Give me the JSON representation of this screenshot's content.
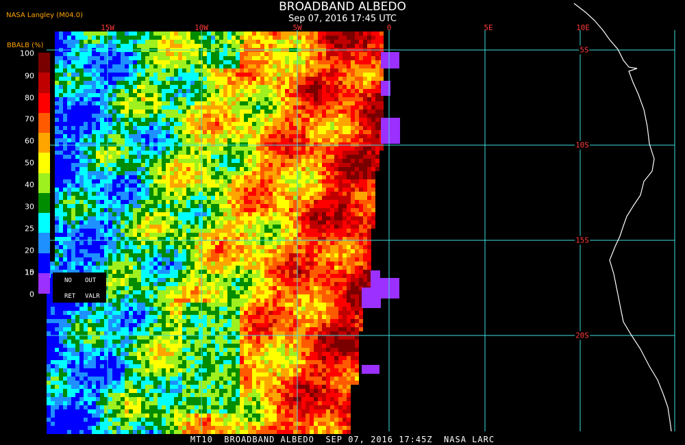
{
  "header": {
    "title": "BROADBAND ALBEDO",
    "subtitle": "Sep 07, 2016 17:45 UTC",
    "credit": "NASA Langley (M04.0)"
  },
  "footer": {
    "text": "MT10  BROADBAND ALBEDO  SEP 07, 2016 17:45Z  NASA LARC"
  },
  "map": {
    "longitude_labels": [
      "15W",
      "10W",
      "5W",
      "0",
      "5E",
      "10E"
    ],
    "latitude_labels": [
      "5S",
      "10S",
      "15S",
      "20S"
    ],
    "grid_color": "#40e0e0",
    "label_color": "#ff3b3b",
    "coast_color": "#ffffff",
    "background_color": "#000000",
    "dominant_features": [
      "stratocumulus cloud deck over ocean",
      "no-retrieval strip along 0 meridian"
    ]
  },
  "legend": {
    "title": "BBALB (%)",
    "ticks": [
      "100",
      "90",
      "80",
      "70",
      "60",
      "50",
      "40",
      "30",
      "25",
      "20",
      "15",
      "10",
      "0"
    ],
    "colors": [
      "#7a0000",
      "#c00000",
      "#ff0000",
      "#ff5a00",
      "#ffa500",
      "#ffff00",
      "#9ef01e",
      "#008c00",
      "#00ffff",
      "#1e90ff",
      "#0000ff",
      "#9b30ff"
    ],
    "flags": {
      "no": "NO",
      "out": "OUT",
      "ret": "RET",
      "valr": "VALR"
    }
  }
}
